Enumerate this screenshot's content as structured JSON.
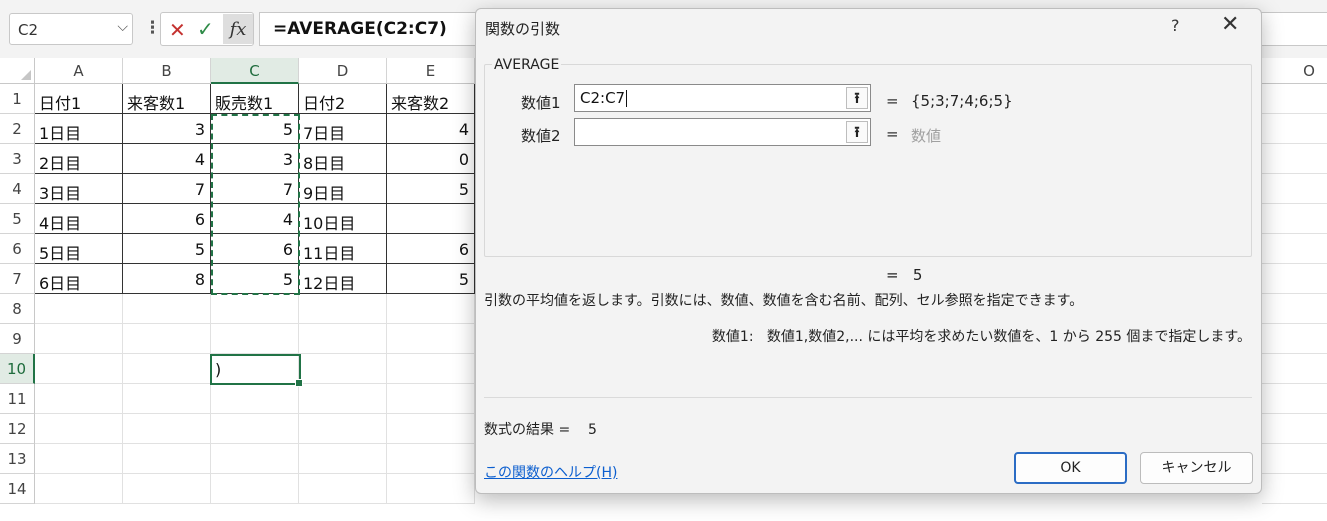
{
  "formula_bar": {
    "name_box": "C2",
    "cancel_icon": "✕",
    "enter_icon": "✓",
    "fx_label": "fx",
    "formula_prefix": "=AVERAGE",
    "formula_args": "(C2:C7)"
  },
  "sheet": {
    "columns": [
      "A",
      "B",
      "C",
      "D",
      "E",
      "O"
    ],
    "rows": [
      "1",
      "2",
      "3",
      "4",
      "5",
      "6",
      "7",
      "8",
      "9",
      "10",
      "11",
      "12",
      "13",
      "14"
    ],
    "headers": [
      "日付1",
      "来客数1",
      "販売数1",
      "日付2",
      "来客数2"
    ],
    "data": [
      [
        "1日目",
        "3",
        "5",
        "7日目",
        "4"
      ],
      [
        "2日目",
        "4",
        "3",
        "8日目",
        "0"
      ],
      [
        "3日目",
        "7",
        "7",
        "9日目",
        "5"
      ],
      [
        "4日目",
        "6",
        "4",
        "10日目",
        ""
      ],
      [
        "5日目",
        "5",
        "6",
        "11日目",
        "6"
      ],
      [
        "6日目",
        "8",
        "5",
        "12日目",
        "5"
      ]
    ],
    "active_cell_text": ")"
  },
  "dialog": {
    "title": "関数の引数",
    "help_icon": "?",
    "close_icon": "✕",
    "function_name": "AVERAGE",
    "args": [
      {
        "label": "数値1",
        "value": "C2:C7",
        "eq": "=",
        "result": "{5;3;7;4;6;5}"
      },
      {
        "label": "数値2",
        "value": "",
        "eq": "=",
        "result": "数値"
      }
    ],
    "result_line": "=   5",
    "description": "引数の平均値を返します。引数には、数値、数値を含む名前、配列、セル参照を指定できます。",
    "arg_description": "数値1:   数値1,数値2,... には平均を求めたい数値を、1 から 255 個まで指定します。",
    "formula_result": "数式の結果 =    5",
    "help_link": "この関数のヘルプ(H)",
    "ok_label": "OK",
    "cancel_label": "キャンセル"
  }
}
